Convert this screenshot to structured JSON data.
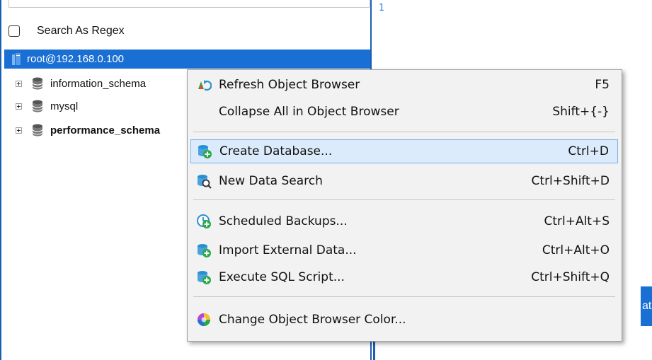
{
  "browser": {
    "search_as_regex_label": "Search As Regex",
    "root_connection": "root@192.168.0.100",
    "databases": [
      {
        "name": "information_schema",
        "bold": false
      },
      {
        "name": "mysql",
        "bold": false
      },
      {
        "name": "performance_schema",
        "bold": true
      }
    ]
  },
  "editor": {
    "line_number": "1",
    "right_button_fragment": "at"
  },
  "context_menu": {
    "items": [
      {
        "label": "Refresh Object Browser",
        "shortcut": "F5",
        "icon": "refresh-icon"
      },
      {
        "label": "Collapse All in Object Browser",
        "shortcut": "Shift+{-}",
        "icon": ""
      },
      {
        "label": "Create Database...",
        "shortcut": "Ctrl+D",
        "icon": "database-add-icon",
        "highlighted": true
      },
      {
        "label": "New Data Search",
        "shortcut": "Ctrl+Shift+D",
        "icon": "database-search-icon"
      },
      {
        "label": "Scheduled Backups...",
        "shortcut": "Ctrl+Alt+S",
        "icon": "clock-add-icon"
      },
      {
        "label": "Import External Data...",
        "shortcut": "Ctrl+Alt+O",
        "icon": "database-import-icon"
      },
      {
        "label": "Execute SQL Script...",
        "shortcut": "Ctrl+Shift+Q",
        "icon": "database-execute-icon"
      },
      {
        "label": "Change Object Browser Color...",
        "shortcut": "",
        "icon": "color-wheel-icon"
      }
    ]
  },
  "colors": {
    "selection_blue": "#1a6fd4",
    "menu_highlight": "#dcebfb",
    "icon_teal": "#2a8fd0",
    "icon_green": "#2aa84a"
  }
}
